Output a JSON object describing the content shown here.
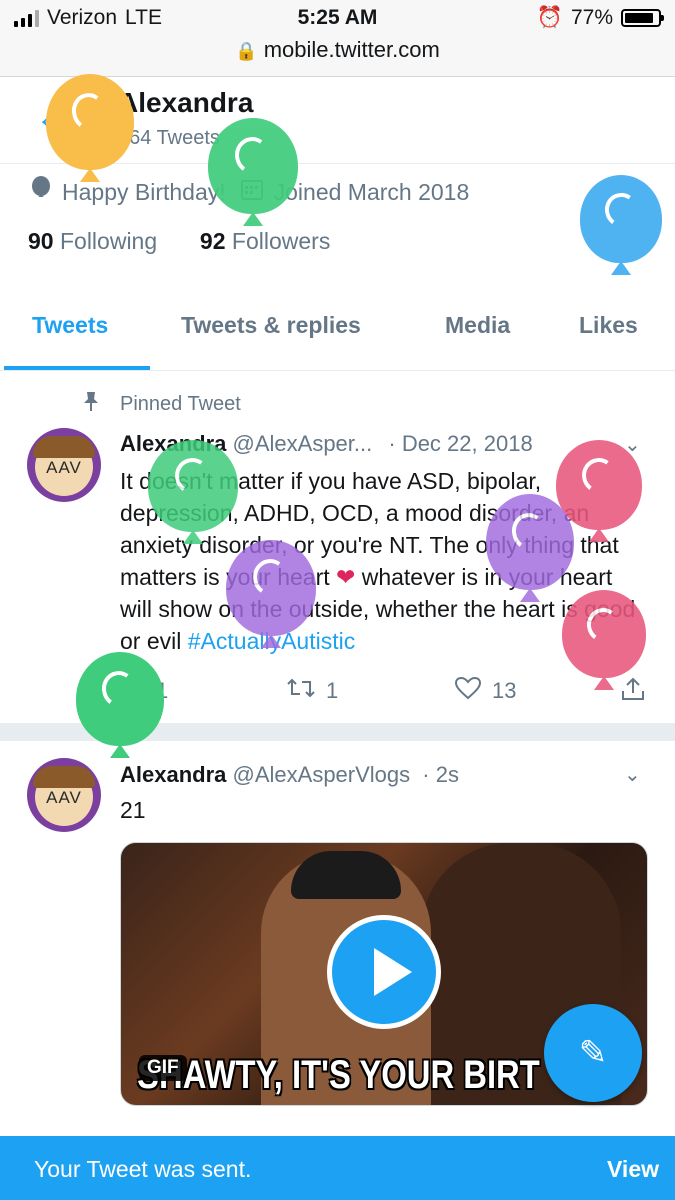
{
  "status_bar": {
    "carrier": "Verizon",
    "network": "LTE",
    "time": "5:25 AM",
    "battery": "77%"
  },
  "browser": {
    "url": "mobile.twitter.com"
  },
  "profile": {
    "name": "Alexandra",
    "tweet_count": "864 Tweets",
    "birthday": "Happy Birthday!",
    "joined": "Joined March 2018",
    "following_count": "90",
    "following_label": "Following",
    "followers_count": "92",
    "followers_label": "Followers"
  },
  "tabs": [
    {
      "label": "Tweets",
      "active": true
    },
    {
      "label": "Tweets & replies"
    },
    {
      "label": "Media"
    },
    {
      "label": "Likes"
    }
  ],
  "pinned_tweet": {
    "pinned_label": "Pinned Tweet",
    "name": "Alexandra",
    "handle": "@AlexAsper...",
    "date": "· Dec 22, 2018",
    "text_part1": "It doesn't matter if you have ASD, bipolar, depression, ADHD, OCD, a mood disorder, an anxiety disorder, or you're NT. The only thing that matters is your heart ",
    "text_part2": " whatever is in your heart will show on the outside, whether the heart is good or evil ",
    "hashtag": "#ActuallyAutistic",
    "replies": "1",
    "retweets": "1",
    "likes": "13",
    "avatar_text": "AAV"
  },
  "tweet2": {
    "name": "Alexandra",
    "handle": "@AlexAsperVlogs",
    "time": "· 2s",
    "text": "21",
    "gif_badge": "GIF",
    "gif_caption": "SHAWTY, IT'S YOUR BIRT",
    "avatar_text": "AAV"
  },
  "toast": {
    "message": "Your Tweet was sent.",
    "action": "View"
  },
  "colors": {
    "accent": "#1da1f2",
    "secondary_text": "#657786",
    "heart": "#e0245e"
  },
  "icons": [
    "back-arrow-icon",
    "balloon-icon",
    "calendar-icon",
    "pin-icon",
    "chevron-down-icon",
    "reply-icon",
    "retweet-icon",
    "like-icon",
    "share-icon",
    "compose-icon",
    "lock-icon",
    "alarm-icon"
  ]
}
